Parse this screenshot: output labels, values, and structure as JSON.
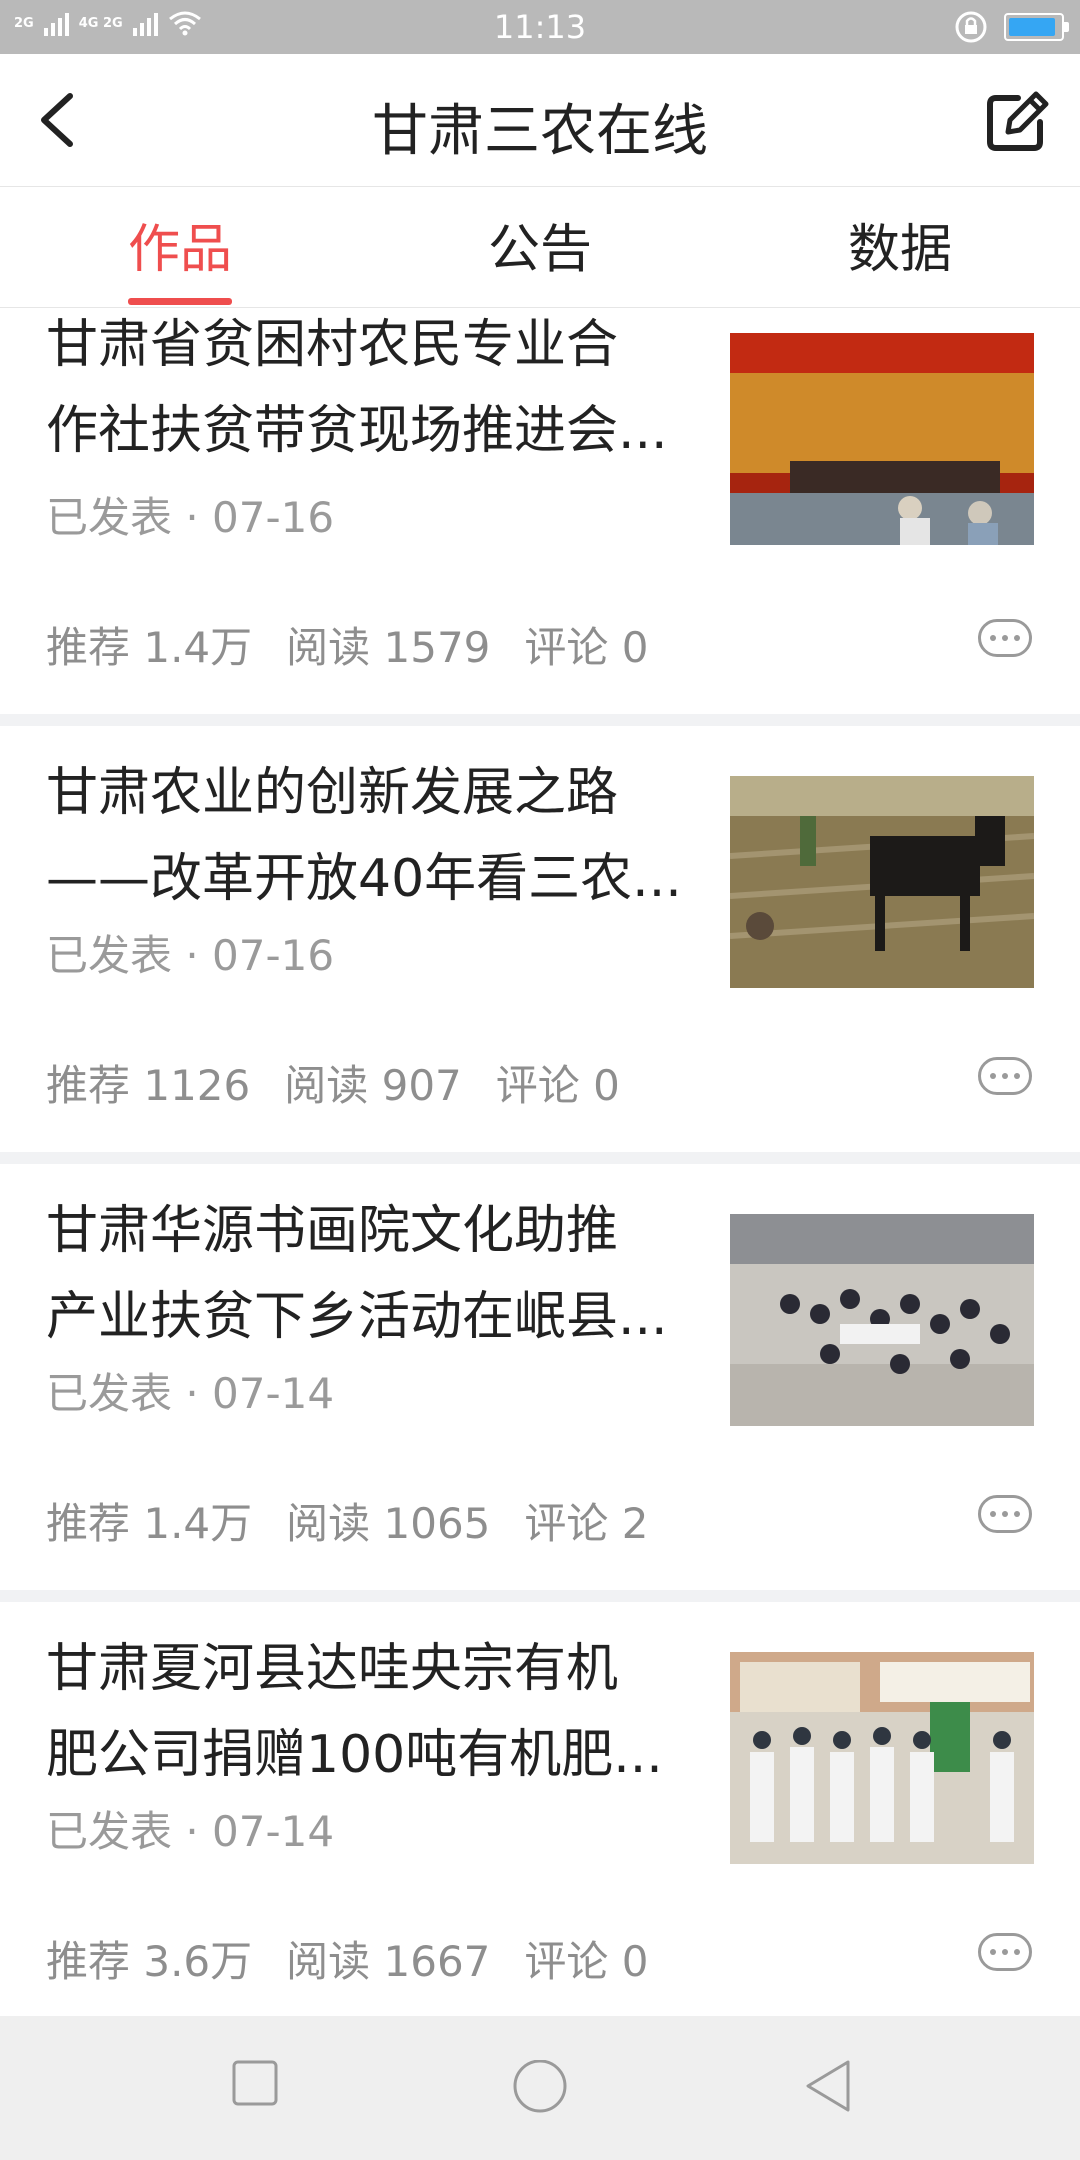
{
  "status_bar": {
    "time": "11:13",
    "signal1": "2G",
    "signal2": "4G 2G"
  },
  "header": {
    "title": "甘肃三农在线"
  },
  "tabs": [
    {
      "label": "作品",
      "active": true
    },
    {
      "label": "公告",
      "active": false
    },
    {
      "label": "数据",
      "active": false
    }
  ],
  "articles": [
    {
      "title_line1": "甘肃省贫困村农民专业合",
      "title_line2": "作社扶贫带贫现场推进会...",
      "meta": "已发表 · 07-16",
      "recommend": "推荐 1.4万",
      "reads": "阅读 1579",
      "comments": "评论 0",
      "thumb_icon": "conference-photo"
    },
    {
      "title_line1": "甘肃农业的创新发展之路",
      "title_line2": "——改革开放40年看三农...",
      "meta": "已发表 · 07-16",
      "recommend": "推荐 1126",
      "reads": "阅读 907",
      "comments": "评论 0",
      "thumb_icon": "farm-donkey-photo"
    },
    {
      "title_line1": "甘肃华源书画院文化助推",
      "title_line2": "产业扶贫下乡活动在岷县...",
      "meta": "已发表 · 07-14",
      "recommend": "推荐 1.4万",
      "reads": "阅读 1065",
      "comments": "评论 2",
      "thumb_icon": "crowd-event-photo"
    },
    {
      "title_line1": "甘肃夏河县达哇央宗有机",
      "title_line2": "肥公司捐赠100吨有机肥...",
      "meta": "已发表 · 07-14",
      "recommend": "推荐 3.6万",
      "reads": "阅读 1667",
      "comments": "评论 0",
      "thumb_icon": "donation-ceremony-photo"
    }
  ],
  "colors": {
    "accent": "#ef4e4e",
    "status_bar": "#b9b9b9",
    "separator": "#f1f2f4",
    "navbar": "#efefef"
  },
  "nav_icons": [
    "recent-apps-icon",
    "home-icon",
    "back-triangle-icon"
  ]
}
